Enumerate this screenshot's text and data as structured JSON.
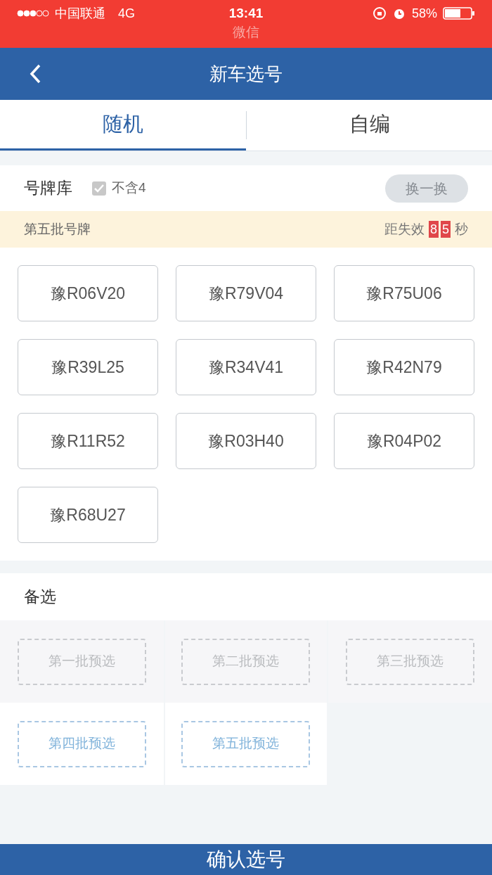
{
  "status_bar": {
    "carrier": "中国联通",
    "network": "4G",
    "time": "13:41",
    "battery": "58%",
    "back_app": "微信"
  },
  "header": {
    "title": "新车选号"
  },
  "tabs": [
    {
      "label": "随机",
      "selected": true
    },
    {
      "label": "自编",
      "selected": false
    }
  ],
  "plate_pool": {
    "title": "号牌库",
    "exclude_four": {
      "label": "不含4",
      "checked": true
    },
    "refresh_button": {
      "label": "换一换",
      "disabled": true
    },
    "batch": {
      "label": "第五批号牌",
      "countdown_prefix": "距失效",
      "countdown_digits": [
        "8",
        "5"
      ],
      "countdown_suffix": "秒"
    },
    "plates": [
      "豫R06V20",
      "豫R79V04",
      "豫R75U06",
      "豫R39L25",
      "豫R34V41",
      "豫R42N79",
      "豫R11R52",
      "豫R03H40",
      "豫R04P02",
      "豫R68U27"
    ]
  },
  "backup": {
    "title": "备选",
    "slots": [
      {
        "label": "第一批预选",
        "active": false
      },
      {
        "label": "第二批预选",
        "active": false
      },
      {
        "label": "第三批预选",
        "active": false
      },
      {
        "label": "第四批预选",
        "active": true
      },
      {
        "label": "第五批预选",
        "active": true
      }
    ]
  },
  "confirm_button": {
    "label": "确认选号"
  }
}
